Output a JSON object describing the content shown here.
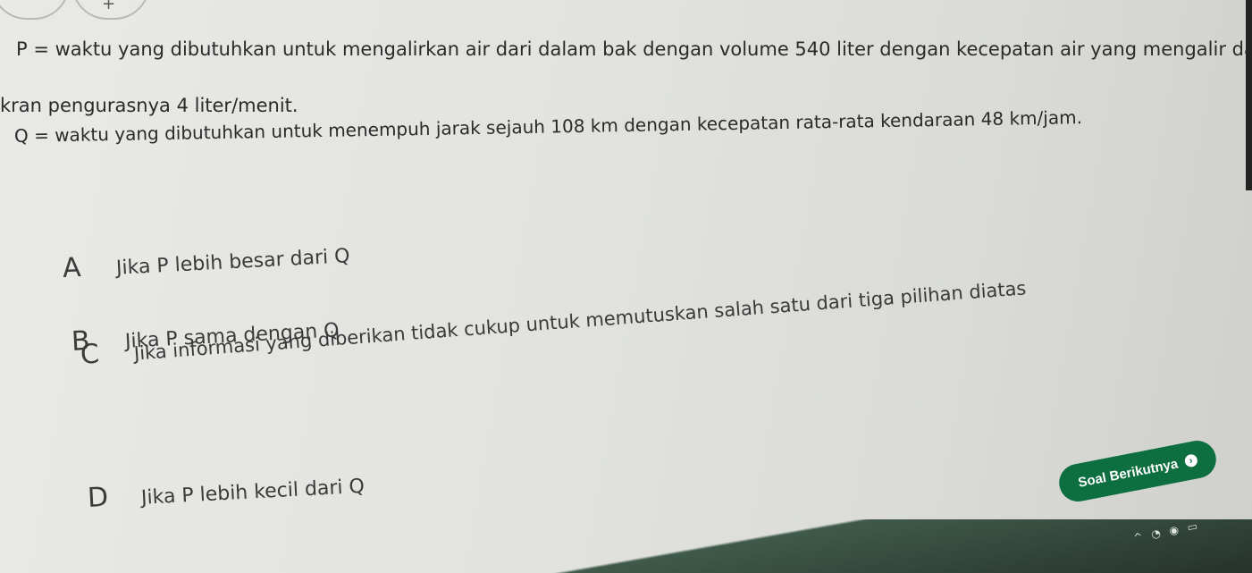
{
  "question": {
    "p_line1": "P = waktu yang dibutuhkan untuk mengalirkan air dari dalam bak dengan volume 540 liter dengan kecepatan air yang mengalir dari",
    "p_line2": "kran pengurasnya 4 liter/menit.",
    "q_line": "Q = waktu yang dibutuhkan untuk menempuh jarak sejauh 108 km dengan kecepatan rata-rata kendaraan 48 km/jam."
  },
  "options": [
    {
      "letter": "A",
      "text": "Jika P lebih besar dari Q"
    },
    {
      "letter": "B",
      "text": "Jika P sama dengan Q"
    },
    {
      "letter": "C",
      "text": "Jika informasi yang diberikan tidak cukup untuk memutuskan salah satu dari tiga pilihan diatas"
    },
    {
      "letter": "D",
      "text": "Jika P lebih kecil dari Q"
    }
  ],
  "next_button": {
    "label": "Soal Berikutnya",
    "icon": "chevron-right-icon",
    "color": "#0d6e3f"
  },
  "tray": {
    "icons": [
      "chevron-up-icon",
      "network-icon",
      "volume-icon",
      "battery-icon"
    ]
  }
}
